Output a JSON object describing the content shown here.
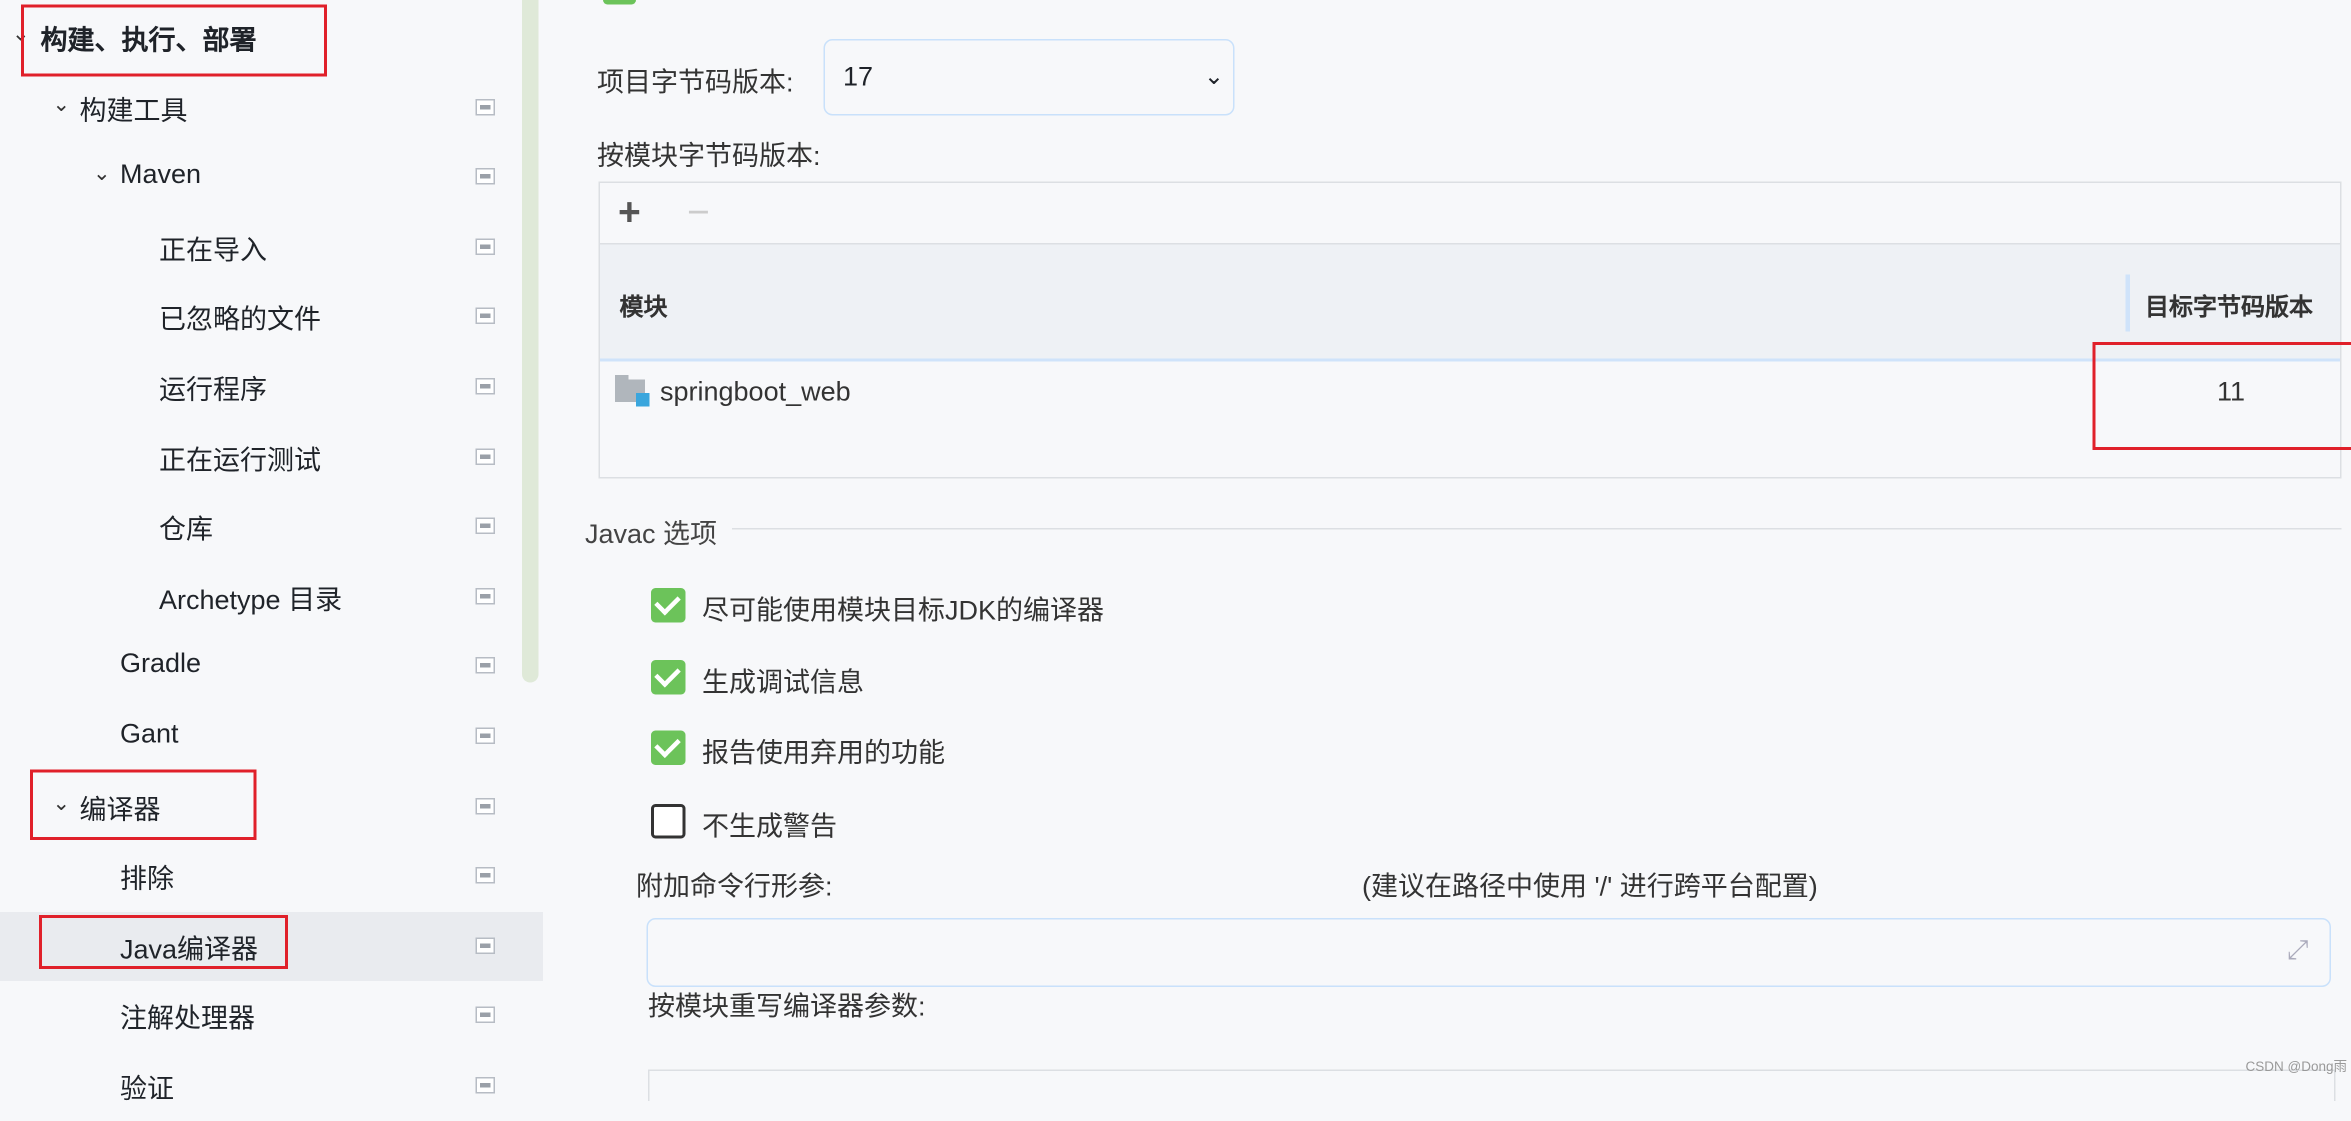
{
  "sidebar": {
    "items": [
      {
        "label": "构建、执行、部署",
        "expanded": true,
        "level": 0
      },
      {
        "label": "构建工具",
        "expanded": true,
        "level": 1
      },
      {
        "label": "Maven",
        "expanded": true,
        "level": 2
      },
      {
        "label": "正在导入",
        "level": 3
      },
      {
        "label": "已忽略的文件",
        "level": 3
      },
      {
        "label": "运行程序",
        "level": 3
      },
      {
        "label": "正在运行测试",
        "level": 3
      },
      {
        "label": "仓库",
        "level": 3
      },
      {
        "label": "Archetype 目录",
        "level": 3
      },
      {
        "label": "Gradle",
        "level": 2
      },
      {
        "label": "Gant",
        "level": 2
      },
      {
        "label": "编译器",
        "expanded": true,
        "level": 1
      },
      {
        "label": "排除",
        "level": 2
      },
      {
        "label": "Java编译器",
        "level": 2,
        "selected": true
      },
      {
        "label": "注解处理器",
        "level": 2
      },
      {
        "label": "验证",
        "level": 2
      }
    ]
  },
  "main": {
    "project_bytecode_label": "项目字节码版本:",
    "project_bytecode_value": "17",
    "per_module_label": "按模块字节码版本:",
    "table": {
      "add": "+",
      "remove": "−",
      "columns": [
        "模块",
        "目标字节码版本"
      ],
      "rows": [
        {
          "module": "springboot_web",
          "version": "11"
        }
      ]
    },
    "javac_section": "Javac 选项",
    "options": [
      {
        "label": "尽可能使用模块目标JDK的编译器",
        "checked": true
      },
      {
        "label": "生成调试信息",
        "checked": true
      },
      {
        "label": "报告使用弃用的功能",
        "checked": true
      },
      {
        "label": "不生成警告",
        "checked": false
      }
    ],
    "extra_args_label": "附加命令行形参:",
    "extra_args_hint": "(建议在路径中使用 '/' 进行跨平台配置)",
    "extra_args_value": "",
    "override_label": "按模块重写编译器参数:"
  },
  "watermark": "CSDN @Dong雨",
  "colors": {
    "accent_check": "#6cc35a",
    "highlight_red": "#e0202a",
    "selected_row": "#e9ebef"
  }
}
